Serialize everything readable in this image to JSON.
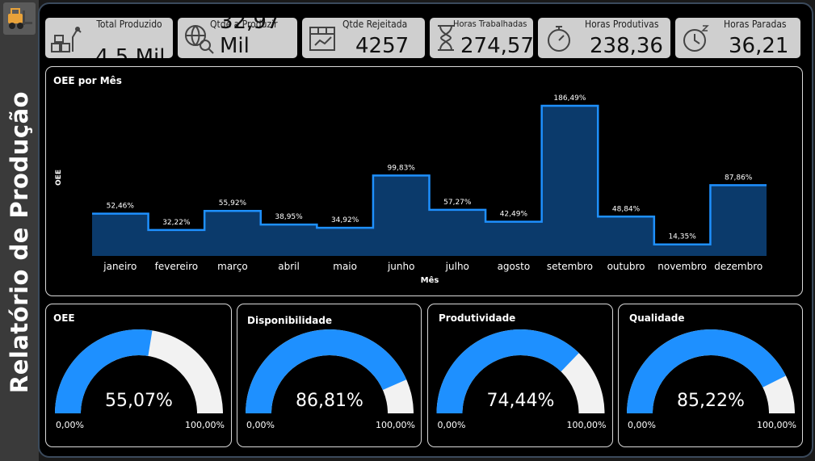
{
  "report_title": "Relatório de Produção",
  "kpis": {
    "total": {
      "label": "Total Produzido",
      "value": "4,5 Mil"
    },
    "to_produce": {
      "label": "Qtde a Produzir",
      "value": "32,97 Mil"
    },
    "rejected": {
      "label": "Qtde Rejeitada",
      "value": "4257"
    },
    "hours_worked": {
      "label": "Horas Trabalhadas",
      "value": "274,57"
    },
    "hours_productive": {
      "label": "Horas Produtivas",
      "value": "238,36"
    },
    "hours_stopped": {
      "label": "Horas Paradas",
      "value": "36,21"
    }
  },
  "gauges": [
    {
      "title": "OEE",
      "value": 55.07,
      "value_label": "55,07%",
      "min_label": "0,00%",
      "max_label": "100,00%"
    },
    {
      "title": "Disponibilidade",
      "value": 86.81,
      "value_label": "86,81%",
      "min_label": "0,00%",
      "max_label": "100,00%"
    },
    {
      "title": "Produtividade",
      "value": 74.44,
      "value_label": "74,44%",
      "min_label": "0,00%",
      "max_label": "100,00%"
    },
    {
      "title": "Qualidade",
      "value": 85.22,
      "value_label": "85,22%",
      "min_label": "0,00%",
      "max_label": "100,00%"
    }
  ],
  "colors": {
    "accent": "#1e90ff",
    "area": "#0b3a6b",
    "gauge_rest": "#f2f2f2",
    "kpi_bg": "#cfcfcf"
  },
  "chart_data": {
    "type": "area",
    "title": "OEE por Mês",
    "xlabel": "Mês",
    "ylabel": "OEE",
    "categories": [
      "janeiro",
      "fevereiro",
      "março",
      "abril",
      "maio",
      "junho",
      "julho",
      "agosto",
      "setembro",
      "outubro",
      "novembro",
      "dezembro"
    ],
    "values": [
      52.46,
      32.22,
      55.92,
      38.95,
      34.92,
      99.83,
      57.27,
      42.49,
      186.49,
      48.84,
      14.35,
      87.86
    ],
    "value_labels": [
      "52,46%",
      "32,22%",
      "55,92%",
      "38,95%",
      "34,92%",
      "99,83%",
      "57,27%",
      "42,49%",
      "186,49%",
      "48,84%",
      "14,35%",
      "87,86%"
    ],
    "step": true,
    "grid": false
  }
}
